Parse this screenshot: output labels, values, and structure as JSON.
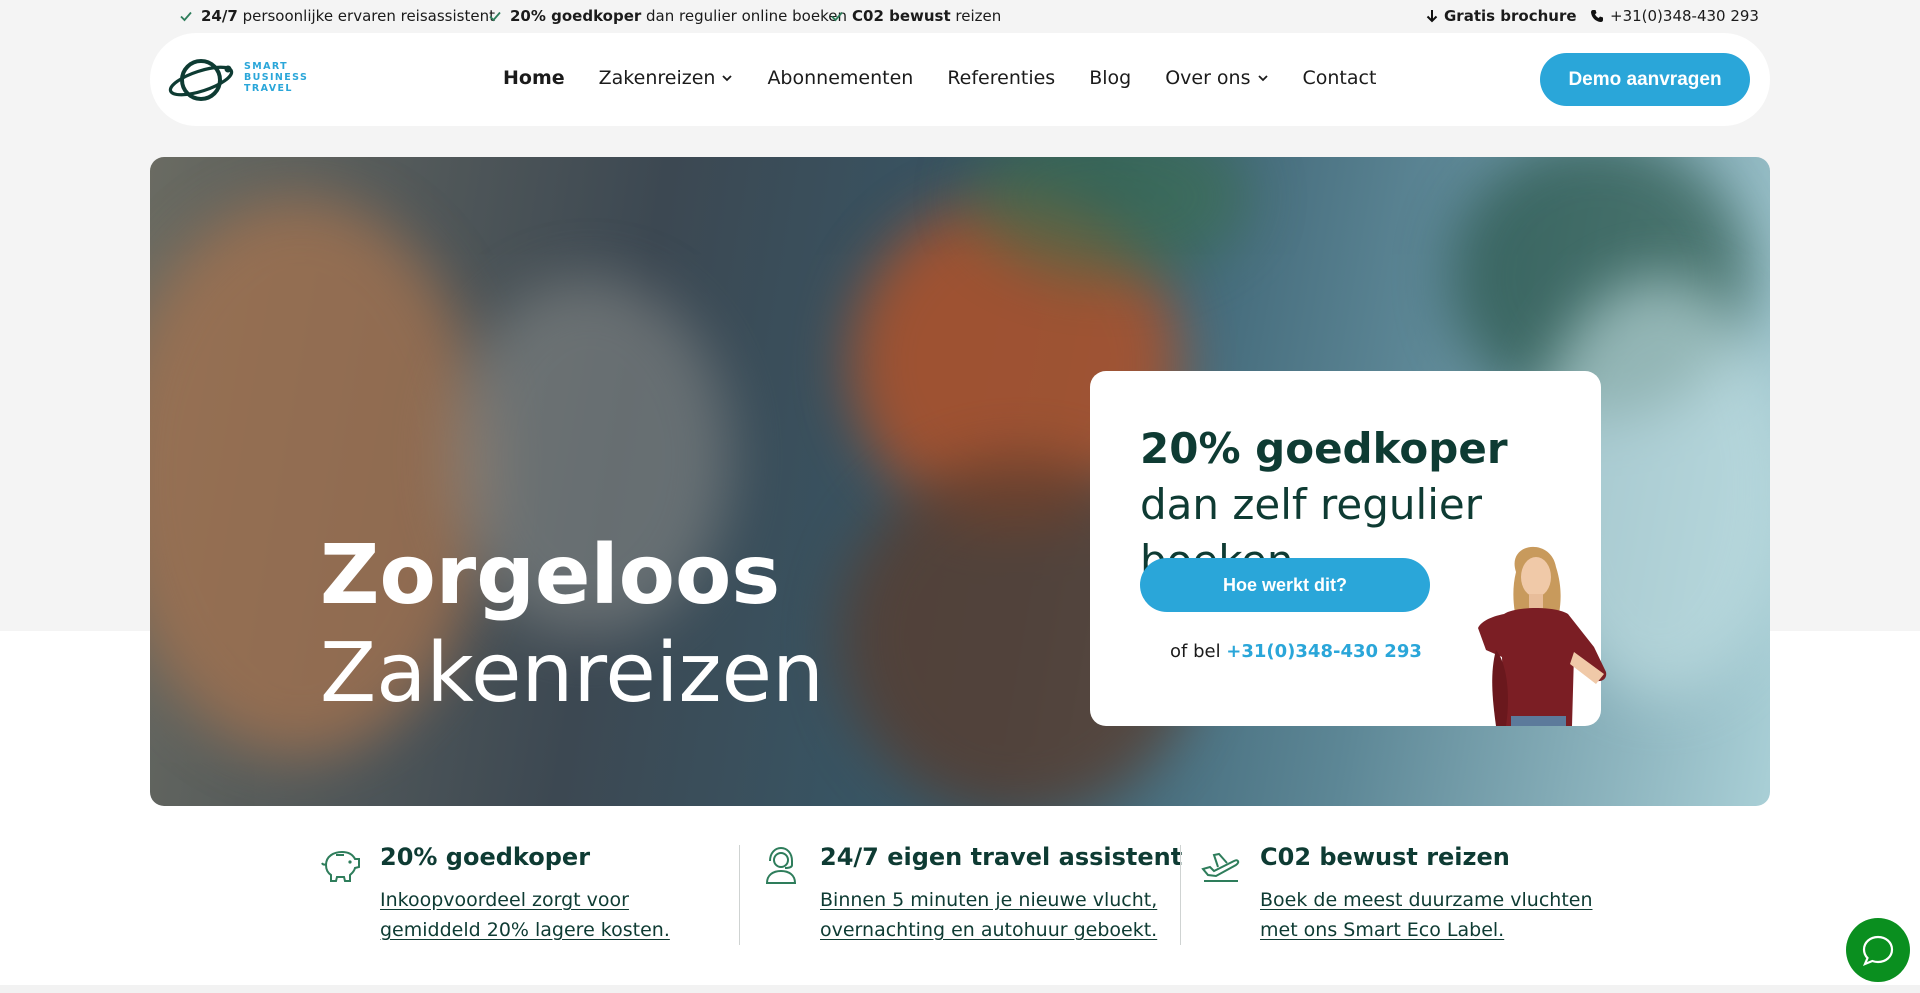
{
  "topbar": {
    "usps": [
      {
        "strong": "24/7",
        "text": " persoonlijke ervaren reisassistent"
      },
      {
        "strong": "20% goedkoper",
        "text": " dan regulier online boeken"
      },
      {
        "strong": "C02 bewust",
        "text": " reizen"
      }
    ],
    "brochure": "Gratis brochure",
    "phone": "+31(0)348-430 293"
  },
  "logo": {
    "lines": [
      "SMART",
      "BUSINESS",
      "TRAVEL"
    ]
  },
  "nav": {
    "items": [
      "Home",
      "Zakenreizen",
      "Abonnementen",
      "Referenties",
      "Blog",
      "Over ons",
      "Contact"
    ],
    "cta": "Demo aanvragen"
  },
  "hero": {
    "title_bold": "Zorgeloos",
    "title_light": "Zakenreizen"
  },
  "card": {
    "heading_bold": "20% goedkoper",
    "heading_rest": " dan zelf regulier boeken",
    "button": "Hoe werkt dit?",
    "call_prefix": "of bel ",
    "call_number": "+31(0)348-430 293"
  },
  "features": [
    {
      "icon": "piggy-bank-icon",
      "title": "20% goedkoper",
      "text": "Inkoopvoordeel zorgt voor gemiddeld 20% lagere kosten."
    },
    {
      "icon": "support-agent-icon",
      "title": "24/7 eigen travel assistent",
      "text": "Binnen 5 minuten je nieuwe vlucht, overnachting en autohuur geboekt."
    },
    {
      "icon": "plane-takeoff-icon",
      "title": "C02 bewust reizen",
      "text": "Boek de meest duurzame vluchten met ons Smart Eco Label."
    }
  ],
  "colors": {
    "accent": "#2aa6d9",
    "dark_green": "#0e3b33",
    "check_green": "#2e7d5b",
    "chat_green": "#0a8f1f"
  }
}
